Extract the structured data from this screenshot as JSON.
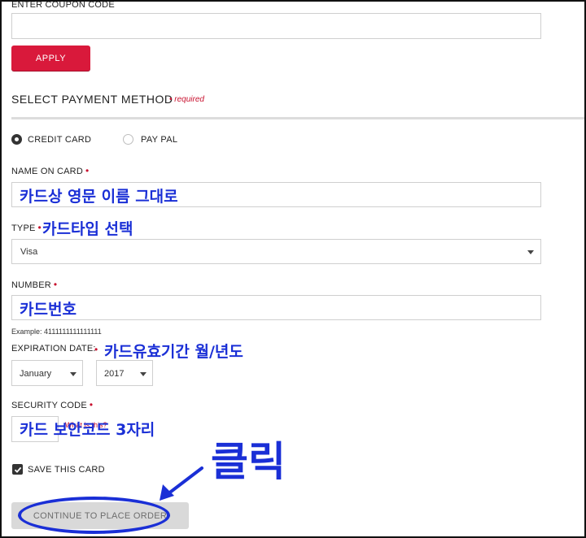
{
  "coupon": {
    "label": "ENTER COUPON CODE",
    "value": "",
    "apply_label": "APPLY"
  },
  "payment": {
    "title": "SELECT PAYMENT METHOD",
    "required_note": "• required",
    "methods": [
      {
        "label": "CREDIT CARD",
        "selected": true
      },
      {
        "label": "PAY PAL",
        "selected": false
      }
    ]
  },
  "card": {
    "name_label": "NAME ON CARD",
    "type_label": "TYPE",
    "type_value": "Visa",
    "number_label": "NUMBER",
    "number_example": "Example: 4111111111111111",
    "expiration_label": "EXPIRATION DATE:",
    "exp_month": "January",
    "exp_year": "2017",
    "security_label": "SECURITY CODE",
    "whats_this": "What is this?",
    "save_label": "SAVE THIS CARD",
    "continue_label": "CONTINUE TO PLACE ORDER"
  },
  "annotations": {
    "name": "카드상 영문 이름 그대로",
    "type": "카드타입 선택",
    "number": "카드번호",
    "expiration": "카드유효기간 월/년도",
    "security": "카드 보안코드 3자리",
    "click": "클릭",
    "color": "#1a2fd6"
  },
  "colors": {
    "accent": "#d9193b",
    "required": "#c8102e",
    "disabled_button": "#d9d9d9"
  }
}
